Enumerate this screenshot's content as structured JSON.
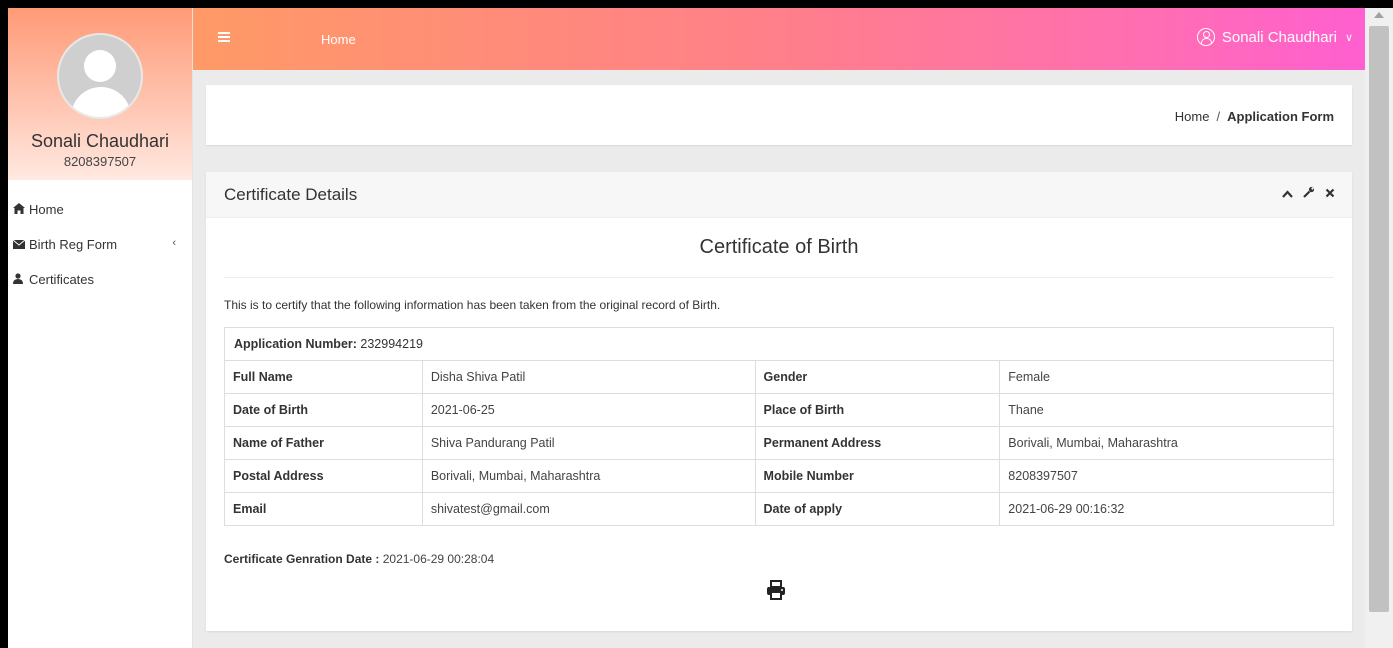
{
  "sidebar": {
    "user_name": "Sonali Chaudhari",
    "user_phone": "8208397507",
    "items": [
      {
        "label": "Home",
        "icon": "home-icon"
      },
      {
        "label": "Birth Reg Form",
        "icon": "envelope-icon",
        "chevron": "‹"
      },
      {
        "label": "Certificates",
        "icon": "user-icon"
      }
    ]
  },
  "header": {
    "home_label": "Home",
    "user_label": "Sonali Chaudhari",
    "caret": "∨"
  },
  "breadcrumb": {
    "home": "Home",
    "separator": "/",
    "current": "Application Form"
  },
  "panel": {
    "title": "Certificate Details",
    "tools": [
      "^",
      "✎",
      "✕"
    ],
    "certificate_title": "Certificate of Birth",
    "intro": "This is to certify that the following information has been taken from the original record of Birth.",
    "application_label": "Application Number:",
    "application_number": "232994219",
    "rows": [
      {
        "k1": "Full Name",
        "v1": "Disha Shiva Patil",
        "k2": "Gender",
        "v2": "Female"
      },
      {
        "k1": "Date of Birth",
        "v1": "2021-06-25",
        "k2": "Place of Birth",
        "v2": "Thane"
      },
      {
        "k1": "Name of Father",
        "v1": "Shiva Pandurang Patil",
        "k2": "Permanent Address",
        "v2": "Borivali, Mumbai, Maharashtra"
      },
      {
        "k1": "Postal Address",
        "v1": "Borivali, Mumbai, Maharashtra",
        "k2": "Mobile Number",
        "v2": "8208397507"
      },
      {
        "k1": "Email",
        "v1": "shivatest@gmail.com",
        "k2": "Date of apply",
        "v2": "2021-06-29 00:16:32"
      }
    ],
    "generation_label": "Certificate Genration Date :",
    "generation_date": "2021-06-29 00:28:04"
  },
  "colors": {
    "header_start": "#ff9a66",
    "header_end": "#ff5fd0",
    "panel_bg": "#ffffff",
    "app_bg": "#ebebeb"
  }
}
